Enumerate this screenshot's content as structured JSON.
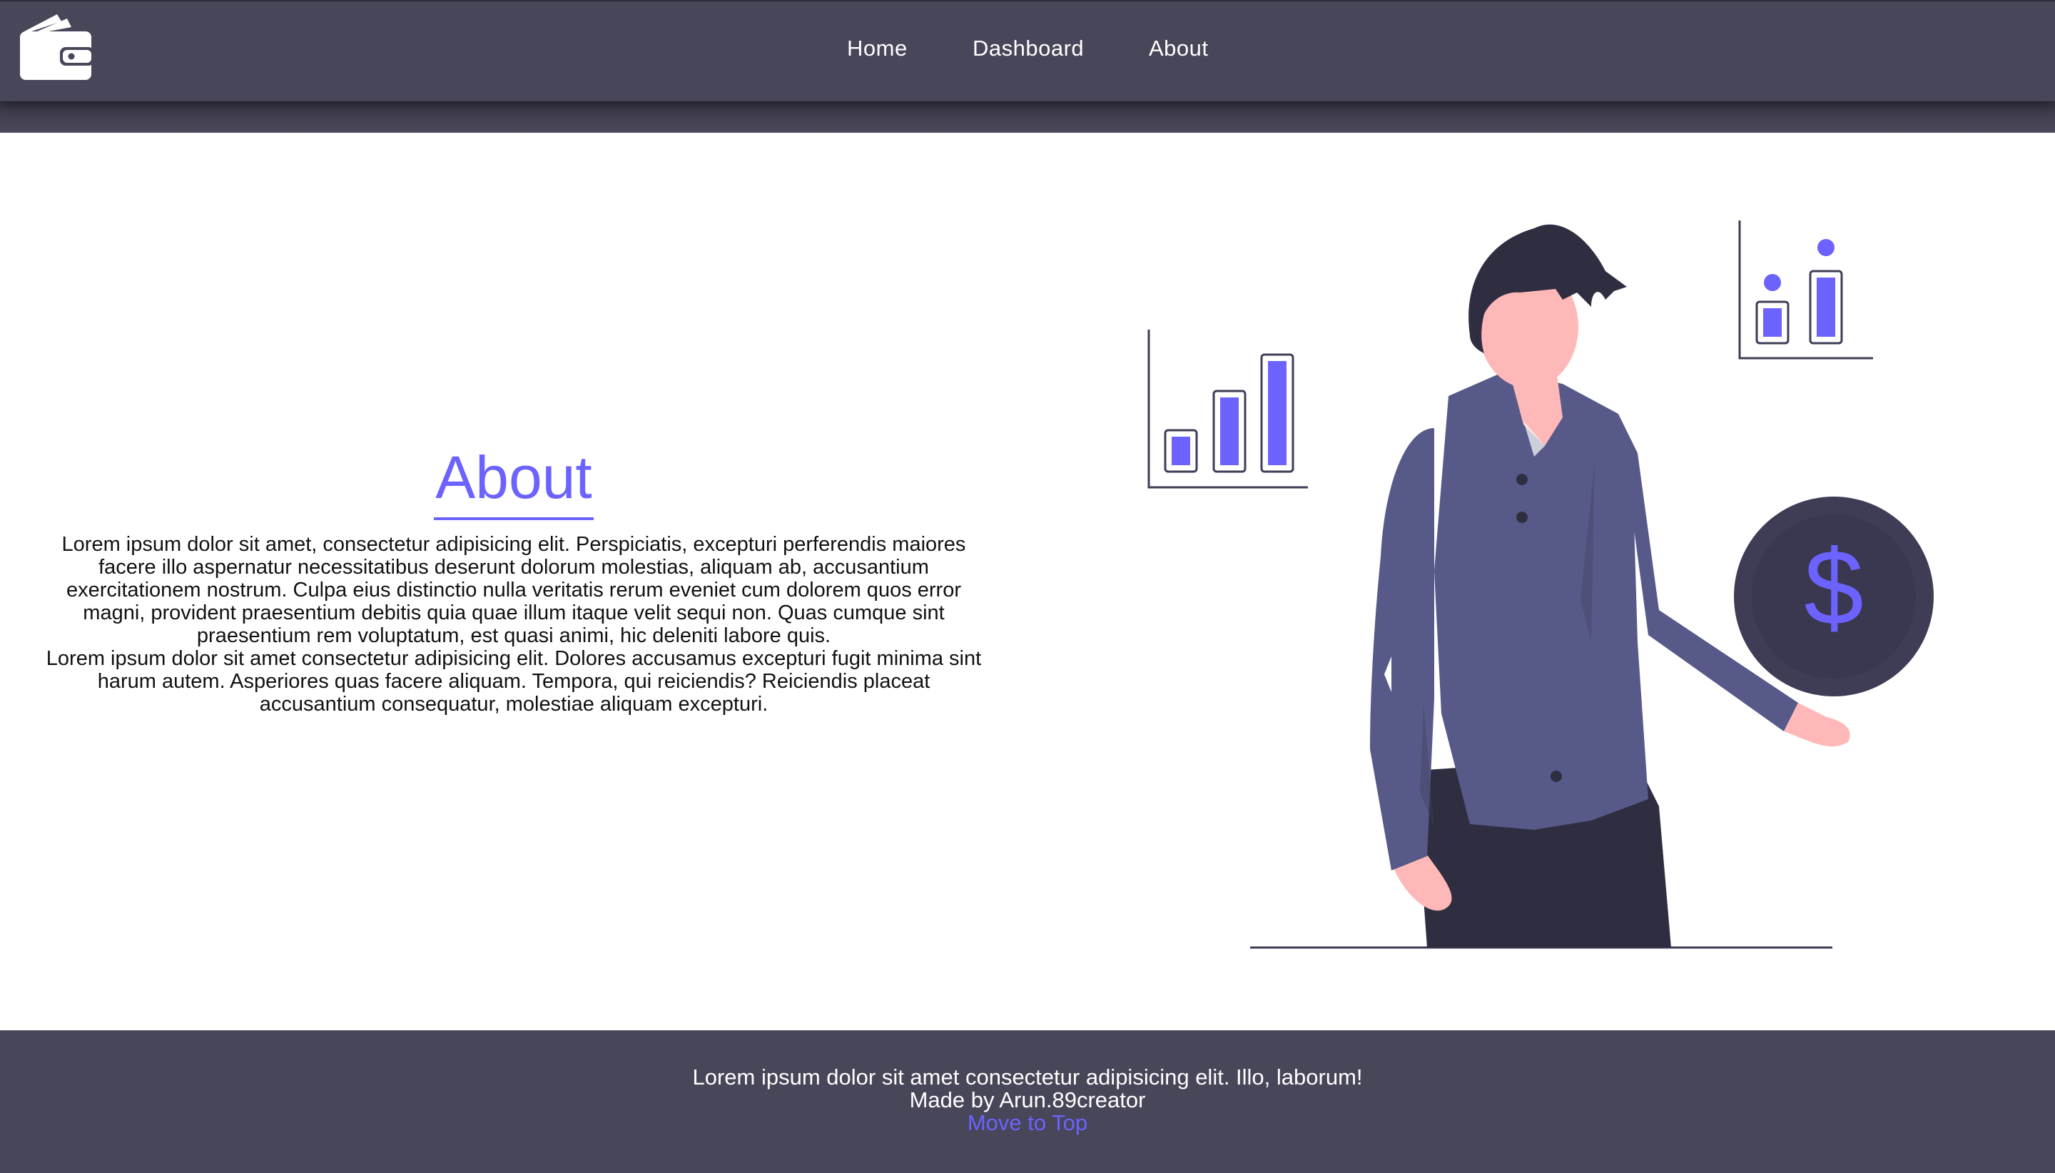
{
  "nav": {
    "logo_icon": "wallet-icon",
    "links": [
      {
        "label": "Home"
      },
      {
        "label": "Dashboard"
      },
      {
        "label": "About"
      }
    ]
  },
  "about": {
    "title": "About",
    "paragraphs": [
      "Lorem ipsum dolor sit amet, consectetur adipisicing elit. Perspiciatis, excepturi perferendis maiores facere illo aspernatur necessitatibus deserunt dolorum molestias, aliquam ab, accusantium exercitationem nostrum. Culpa eius distinctio nulla veritatis rerum eveniet cum dolorem quos error magni, provident praesentium debitis quia quae illum itaque velit sequi non. Quas cumque sint praesentium rem voluptatum, est quasi animi, hic deleniti labore quis.",
      "Lorem ipsum dolor sit amet consectetur adipisicing elit. Dolores accusamus excepturi fugit minima sint harum autem. Asperiores quas facere aliquam. Tempora, qui reiciendis? Reiciendis placeat accusantium consequatur, molestiae aliquam excepturi."
    ],
    "illustration": {
      "coin_symbol": "$"
    }
  },
  "footer": {
    "tagline": "Lorem ipsum dolor sit amet consectetur adipisicing elit. Illo, laborum!",
    "credit": "Made by Arun.89creator",
    "move_to_top": "Move to Top"
  },
  "colors": {
    "accent": "#6c63ff",
    "navbar": "#484659",
    "shirt": "#575a89",
    "dark": "#2f2e41",
    "skin": "#ffb8b8"
  }
}
